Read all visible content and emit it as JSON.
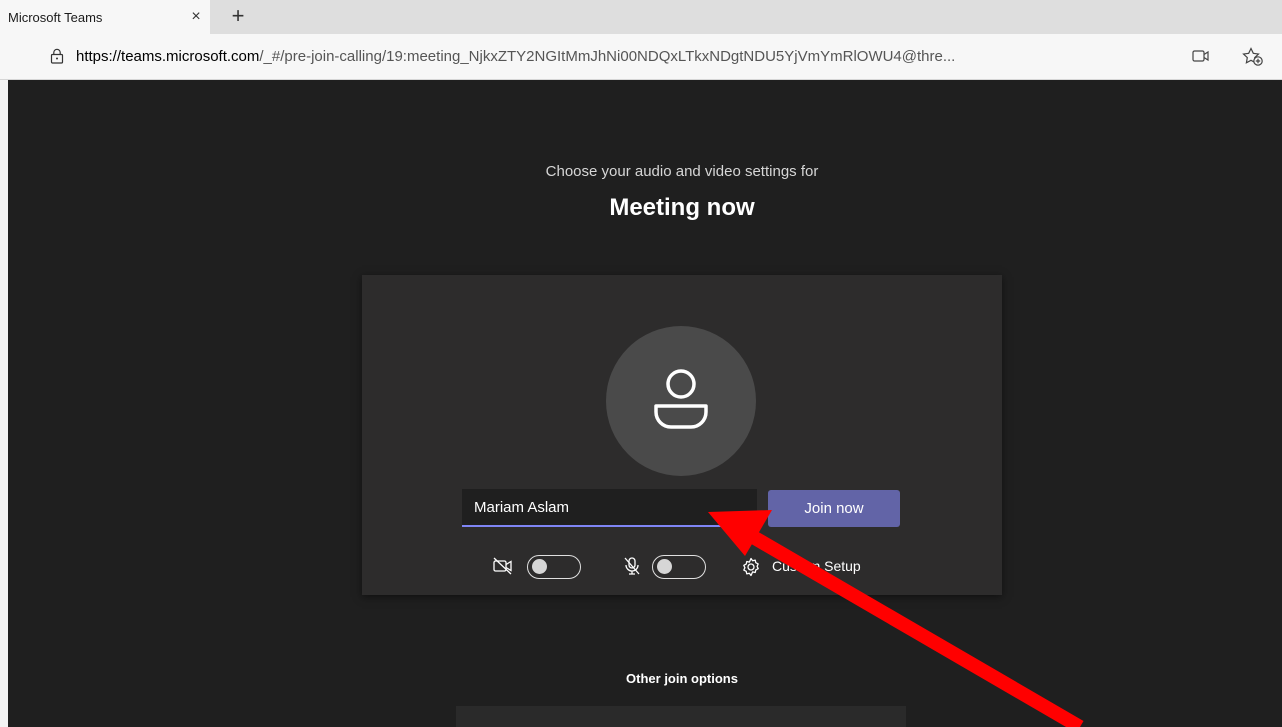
{
  "browser": {
    "tab_title": "Microsoft Teams",
    "close_glyph": "×",
    "new_tab_glyph": "+",
    "url_host": "https://teams.microsoft.com",
    "url_rest": "/_#/pre-join-calling/19:meeting_NjkxZTY2NGItMmJhNi00NDQxLTkxNDgtNDU5YjVmYmRlOWU4@thre..."
  },
  "prejoin": {
    "subtitle": "Choose your audio and video settings for",
    "meeting_title": "Meeting now",
    "name_value": "Mariam Aslam",
    "join_label": "Join now",
    "setup_label": "Custom Setup",
    "camera_on": false,
    "mic_on": false
  },
  "other": {
    "title": "Other join options"
  },
  "colors": {
    "accent": "#6264a7",
    "annotation_arrow": "#ff0000"
  },
  "icons": [
    "lock-icon",
    "person-icon",
    "camera-off-icon",
    "mic-off-icon",
    "gear-icon",
    "favorites-icon",
    "camera-icon"
  ]
}
